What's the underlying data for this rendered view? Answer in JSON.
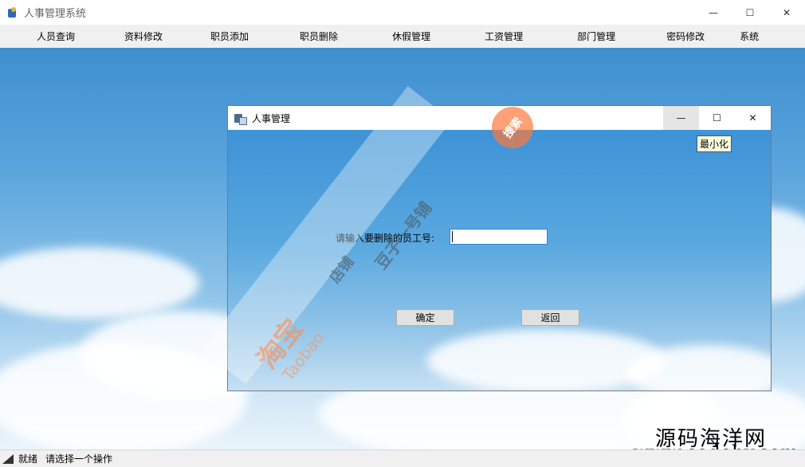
{
  "window": {
    "title": "人事管理系统",
    "minimize_glyph": "—",
    "maximize_glyph": "☐",
    "close_glyph": "✕"
  },
  "menu": {
    "items": [
      {
        "label": "人员查询"
      },
      {
        "label": "资料修改"
      },
      {
        "label": "职员添加"
      },
      {
        "label": "职员删除"
      },
      {
        "label": "休假管理"
      },
      {
        "label": "工资管理"
      },
      {
        "label": "部门管理"
      },
      {
        "label": "密码修改"
      },
      {
        "label": "系统"
      }
    ]
  },
  "dialog": {
    "title": "人事管理",
    "minimize_glyph": "—",
    "maximize_glyph": "☐",
    "close_glyph": "✕",
    "tooltip": "最小化",
    "prompt_label": "请输入要删除的员工号:",
    "employee_id_value": "",
    "confirm_label": "确定",
    "back_label": "返回"
  },
  "watermark": {
    "taobao_cn": "淘宝",
    "taobao_en": "Taobao",
    "shop": "店铺",
    "owner": "豆子一号铺",
    "search": "搜索",
    "site_cn": "源码海洋网",
    "site_url": "www.codehy.com"
  },
  "statusbar": {
    "ready": "就绪",
    "hint": "请选择一个操作"
  }
}
